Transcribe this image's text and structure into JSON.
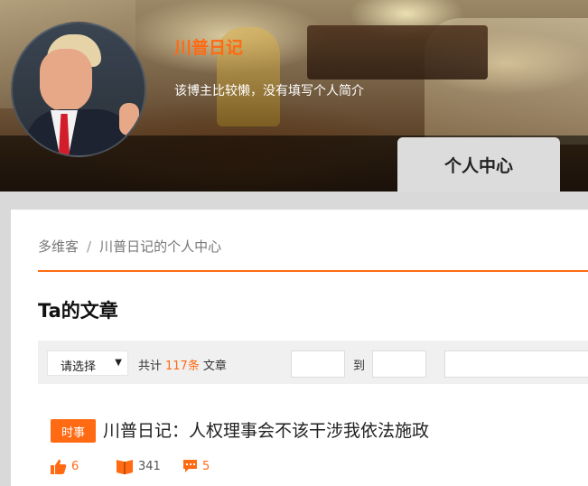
{
  "header": {
    "blog_name": "川普日记",
    "blog_description": "该博主比较懒，没有填写个人简介",
    "tab_label": "个人中心"
  },
  "breadcrumb": {
    "home": "多维客",
    "separator": "/",
    "current": "川普日记的个人中心"
  },
  "section": {
    "title": "Ta的文章"
  },
  "filter": {
    "select_value": "请选择",
    "count_prefix": "共计",
    "count_value": "117条",
    "count_suffix": "文章",
    "to_label": "到"
  },
  "articles": [
    {
      "tag": "时事",
      "title": "川普日记：人权理事会不该干涉我依法施政",
      "likes": "6",
      "reads": "341",
      "comments": "5"
    }
  ],
  "colors": {
    "accent": "#ff6a13"
  },
  "icons": {
    "likes": "thumbs-up-icon",
    "reads": "book-icon",
    "comments": "comment-icon",
    "select_caret": "caret-down-icon"
  }
}
